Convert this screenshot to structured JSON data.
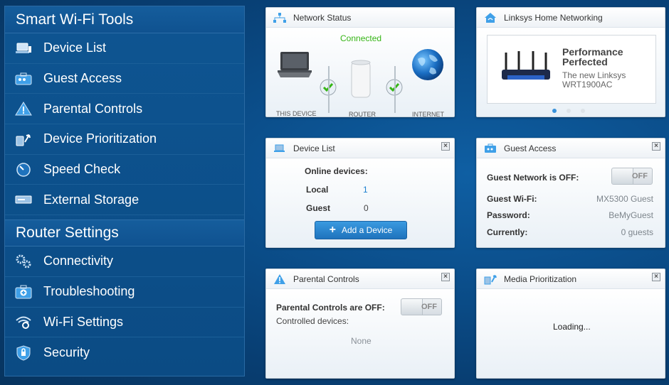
{
  "sidebar": {
    "smart_title": "Smart Wi-Fi Tools",
    "tools": [
      {
        "label": "Device List",
        "icon": "laptop-icon"
      },
      {
        "label": "Guest Access",
        "icon": "guest-icon"
      },
      {
        "label": "Parental Controls",
        "icon": "warning-icon"
      },
      {
        "label": "Device Prioritization",
        "icon": "prioritization-icon"
      },
      {
        "label": "Speed Check",
        "icon": "speedometer-icon"
      },
      {
        "label": "External Storage",
        "icon": "storage-icon"
      }
    ],
    "router_title": "Router Settings",
    "settings": [
      {
        "label": "Connectivity",
        "icon": "gears-icon"
      },
      {
        "label": "Troubleshooting",
        "icon": "medkit-icon"
      },
      {
        "label": "Wi-Fi Settings",
        "icon": "wifi-icon"
      },
      {
        "label": "Security",
        "icon": "shield-icon"
      }
    ]
  },
  "network_status": {
    "title": "Network Status",
    "status": "Connected",
    "this_device": "THIS DEVICE",
    "router": "ROUTER",
    "internet": "INTERNET"
  },
  "linksys": {
    "title": "Linksys Home Networking",
    "headline1": "Performance",
    "headline2": "Perfected",
    "sub1": "The new Linksys",
    "sub2": "WRT1900AC"
  },
  "device_list": {
    "title": "Device List",
    "online": "Online devices:",
    "local_label": "Local",
    "local_value": "1",
    "guest_label": "Guest",
    "guest_value": "0",
    "add_button": "Add a Device"
  },
  "guest_access": {
    "title": "Guest Access",
    "network_off": "Guest Network is OFF:",
    "toggle": "OFF",
    "wifi_label": "Guest Wi-Fi:",
    "wifi_value": "MX5300 Guest",
    "password_label": "Password:",
    "password_value": "BeMyGuest",
    "currently_label": "Currently:",
    "currently_value": "0 guests"
  },
  "parental": {
    "title": "Parental Controls",
    "off": "Parental Controls are OFF:",
    "toggle": "OFF",
    "controlled": "Controlled devices:",
    "none": "None"
  },
  "media": {
    "title": "Media Prioritization",
    "loading": "Loading..."
  },
  "colors": {
    "accent": "#1f73bd",
    "connected": "#36b516",
    "link": "#1a7fd0"
  }
}
